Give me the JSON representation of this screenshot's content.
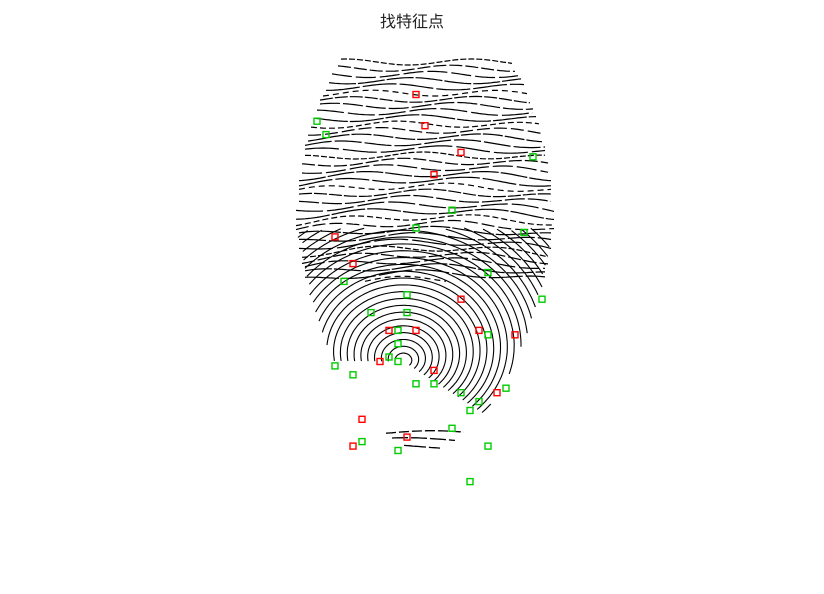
{
  "figure": {
    "title": "找特征点"
  },
  "legend_colors": {
    "red_marker": "#ff0000",
    "green_marker": "#00cc00",
    "ridge": "#000000",
    "background": "#ffffff"
  },
  "markers": {
    "red": [
      {
        "u": 0.5,
        "v": 0.1
      },
      {
        "u": 0.51,
        "v": 0.17
      },
      {
        "u": 0.55,
        "v": 0.23
      },
      {
        "u": 0.52,
        "v": 0.28
      },
      {
        "u": 0.41,
        "v": 0.42
      },
      {
        "u": 0.43,
        "v": 0.48
      },
      {
        "u": 0.55,
        "v": 0.56
      },
      {
        "u": 0.47,
        "v": 0.63
      },
      {
        "u": 0.5,
        "v": 0.63
      },
      {
        "u": 0.57,
        "v": 0.63
      },
      {
        "u": 0.61,
        "v": 0.64
      },
      {
        "u": 0.46,
        "v": 0.7
      },
      {
        "u": 0.52,
        "v": 0.72
      },
      {
        "u": 0.59,
        "v": 0.77
      },
      {
        "u": 0.44,
        "v": 0.83
      },
      {
        "u": 0.49,
        "v": 0.87
      },
      {
        "u": 0.43,
        "v": 0.89
      }
    ],
    "green": [
      {
        "u": 0.39,
        "v": 0.16
      },
      {
        "u": 0.4,
        "v": 0.19
      },
      {
        "u": 0.63,
        "v": 0.24
      },
      {
        "u": 0.54,
        "v": 0.36
      },
      {
        "u": 0.5,
        "v": 0.4
      },
      {
        "u": 0.62,
        "v": 0.41
      },
      {
        "u": 0.42,
        "v": 0.52
      },
      {
        "u": 0.58,
        "v": 0.5
      },
      {
        "u": 0.49,
        "v": 0.55
      },
      {
        "u": 0.64,
        "v": 0.56
      },
      {
        "u": 0.45,
        "v": 0.59
      },
      {
        "u": 0.49,
        "v": 0.59
      },
      {
        "u": 0.48,
        "v": 0.63
      },
      {
        "u": 0.48,
        "v": 0.66
      },
      {
        "u": 0.47,
        "v": 0.69
      },
      {
        "u": 0.58,
        "v": 0.64
      },
      {
        "u": 0.41,
        "v": 0.71
      },
      {
        "u": 0.43,
        "v": 0.73
      },
      {
        "u": 0.48,
        "v": 0.7
      },
      {
        "u": 0.5,
        "v": 0.75
      },
      {
        "u": 0.52,
        "v": 0.75
      },
      {
        "u": 0.55,
        "v": 0.77
      },
      {
        "u": 0.57,
        "v": 0.79
      },
      {
        "u": 0.6,
        "v": 0.76
      },
      {
        "u": 0.56,
        "v": 0.81
      },
      {
        "u": 0.54,
        "v": 0.85
      },
      {
        "u": 0.58,
        "v": 0.89
      },
      {
        "u": 0.44,
        "v": 0.88
      },
      {
        "u": 0.48,
        "v": 0.9
      },
      {
        "u": 0.56,
        "v": 0.97
      }
    ]
  }
}
